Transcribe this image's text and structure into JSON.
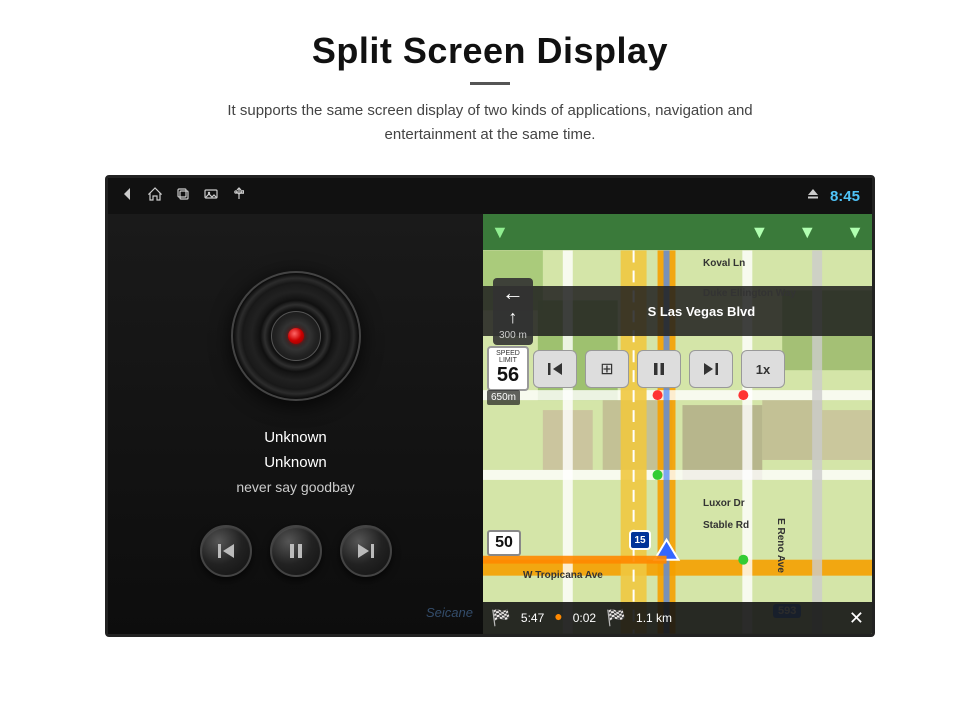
{
  "page": {
    "title": "Split Screen Display",
    "divider": "—",
    "subtitle": "It supports the same screen display of two kinds of applications, navigation and entertainment at the same time."
  },
  "statusBar": {
    "time": "8:45",
    "icons": [
      "back-arrow",
      "home",
      "recent-apps",
      "gallery",
      "usb"
    ]
  },
  "musicPanel": {
    "trackTitle": "Unknown",
    "trackArtist": "Unknown",
    "trackName": "never say goodbay",
    "controls": {
      "prev": "⏮",
      "play": "⏸",
      "next": "⏭"
    },
    "watermark": "Seicane"
  },
  "navPanel": {
    "arrows": [
      "↓",
      "↓",
      "↓",
      "↓"
    ],
    "instruction": {
      "turnLeft": "←",
      "turnRight": "↑",
      "distance": "300 m",
      "roadName": "S Las Vegas Blvd"
    },
    "speedLimit": {
      "label": "SPEED LIMIT",
      "value": "56"
    },
    "dist650": "650m",
    "controls": {
      "prev": "⏮",
      "grid": "⊞",
      "pause": "⏸",
      "next": "⏭",
      "speed": "1x"
    },
    "mapLabels": [
      "Koval Ln",
      "Duke Ellington Way",
      "Luxor Dr",
      "Stable Rd",
      "W Tropicana Ave",
      "E Reno Ave"
    ],
    "bottomBar": {
      "eta": "5:47",
      "time": "0:02",
      "distance": "1.1 km",
      "close": "✕"
    },
    "speedIndicator50": "50",
    "hwyShield15": "15"
  }
}
